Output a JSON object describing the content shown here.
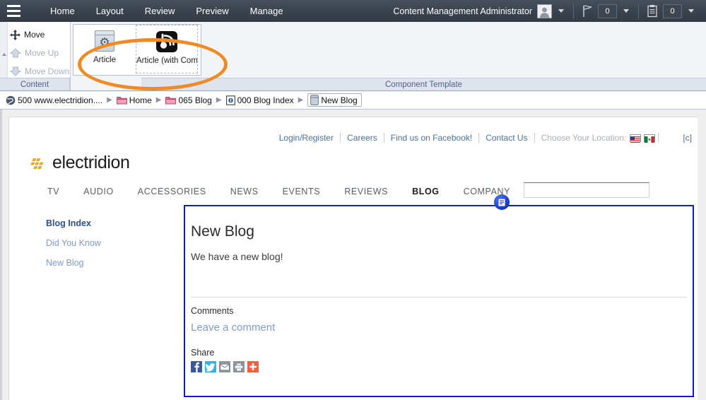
{
  "topbar": {
    "menu_icon": "hamburger-icon",
    "nav": [
      {
        "label": "Home",
        "active": false
      },
      {
        "label": "Layout",
        "active": true
      },
      {
        "label": "Review",
        "active": false
      },
      {
        "label": "Preview",
        "active": false
      },
      {
        "label": "Manage",
        "active": false
      }
    ],
    "user_label": "Content Management Administrator",
    "user_icon": "avatar-icon",
    "flag_icon": "flag-icon",
    "flag_count": "0",
    "clipboard_icon": "clipboard-icon",
    "clipboard_count": "0"
  },
  "ribbon": {
    "buttons": [
      {
        "label": "Move",
        "icon": "move-icon",
        "enabled": true
      },
      {
        "label": "Move Up",
        "icon": "arrow-up-icon",
        "enabled": false
      },
      {
        "label": "Move Down",
        "icon": "arrow-down-icon",
        "enabled": false
      }
    ],
    "group_content_label": "Content",
    "group_template_label": "Component Template",
    "gallery": [
      {
        "label": "Article",
        "icon": "gear-box-icon",
        "selected": false
      },
      {
        "label": "Article (with Com",
        "icon": "blog-rss-icon",
        "selected": true
      }
    ],
    "highlight_color": "#f08a24"
  },
  "breadcrumb": [
    {
      "label": "500 www.electridion....",
      "icon": "globe-icon",
      "current": false
    },
    {
      "label": "Home",
      "icon": "folder-icon",
      "current": false
    },
    {
      "label": "065 Blog",
      "icon": "folder-icon",
      "current": false
    },
    {
      "label": "000 Blog Index",
      "icon": "page-icon",
      "current": false
    },
    {
      "label": "New Blog",
      "icon": "document-icon",
      "current": true
    }
  ],
  "site": {
    "utility_links": [
      "Login/Register",
      "Careers",
      "Find us on Facebook!",
      "Contact Us"
    ],
    "location_label": "Choose Your Location:",
    "flags": [
      "flag-us-icon",
      "flag-mx-icon"
    ],
    "copy_mark": "[c]",
    "logo_text": "electridion",
    "logo_color": "#f0a81e",
    "nav": [
      {
        "label": "TV",
        "active": false
      },
      {
        "label": "AUDIO",
        "active": false
      },
      {
        "label": "ACCESSORIES",
        "active": false
      },
      {
        "label": "NEWS",
        "active": false
      },
      {
        "label": "EVENTS",
        "active": false
      },
      {
        "label": "REVIEWS",
        "active": false
      },
      {
        "label": "BLOG",
        "active": true
      },
      {
        "label": "COMPANY",
        "active": false
      }
    ],
    "search_value": "",
    "search_placeholder": "",
    "sidebar": [
      {
        "label": "Blog Index",
        "active": true
      },
      {
        "label": "Did You Know",
        "active": false
      },
      {
        "label": "New Blog",
        "active": false
      }
    ]
  },
  "component": {
    "badge_icon": "component-marker-icon",
    "selection_color": "#1019cf",
    "title": "New Blog",
    "body": "We have a new blog!",
    "comments_heading": "Comments",
    "leave_comment_link": "Leave a comment",
    "share_heading": "Share",
    "share_buttons": [
      {
        "name": "facebook-share-icon",
        "glyph": "f",
        "color": "#3b5998"
      },
      {
        "name": "twitter-share-icon",
        "glyph": "t",
        "color": "#2fb4e8"
      },
      {
        "name": "email-share-icon",
        "glyph": "m",
        "color": "#8e979f"
      },
      {
        "name": "print-share-icon",
        "glyph": "p",
        "color": "#8e979f"
      },
      {
        "name": "addthis-share-icon",
        "glyph": "+",
        "color": "#f4603e"
      }
    ]
  }
}
